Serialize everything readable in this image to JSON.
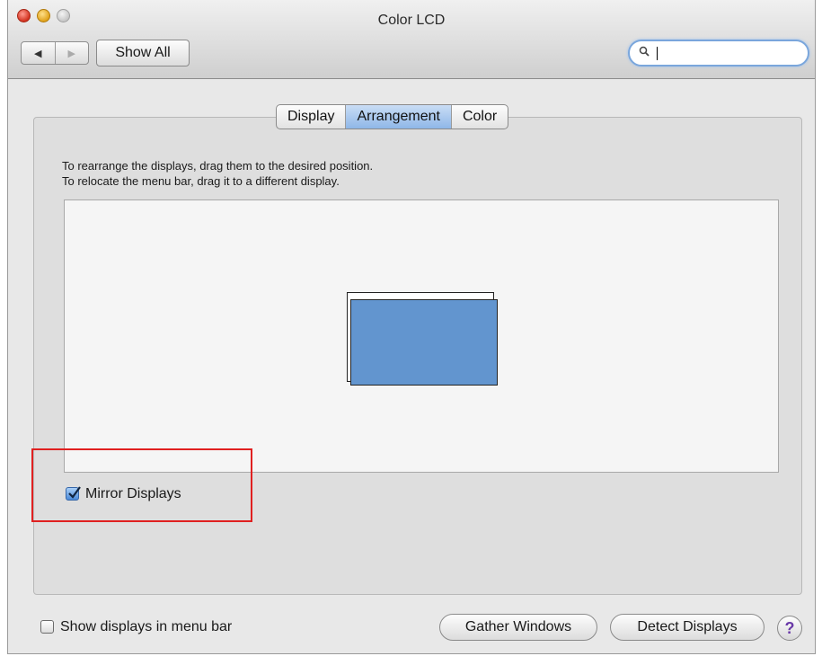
{
  "window": {
    "title": "Color LCD"
  },
  "toolbar": {
    "back_icon": "◀",
    "forward_icon": "▶",
    "show_all": "Show All",
    "search": {
      "value": "",
      "placeholder": ""
    }
  },
  "tabs": [
    {
      "label": "Display",
      "active": false
    },
    {
      "label": "Arrangement",
      "active": true
    },
    {
      "label": "Color",
      "active": false
    }
  ],
  "arrangement": {
    "instructions": [
      "To rearrange the displays, drag them to the desired position.",
      "To relocate the menu bar, drag it to a different display."
    ],
    "display_color": "#6295cf",
    "mirror_displays": {
      "label": "Mirror Displays",
      "checked": true
    }
  },
  "footer": {
    "show_in_menu_bar": {
      "label": "Show displays in menu bar",
      "checked": false
    },
    "gather_windows": "Gather Windows",
    "detect_displays": "Detect Displays",
    "help": "?"
  }
}
